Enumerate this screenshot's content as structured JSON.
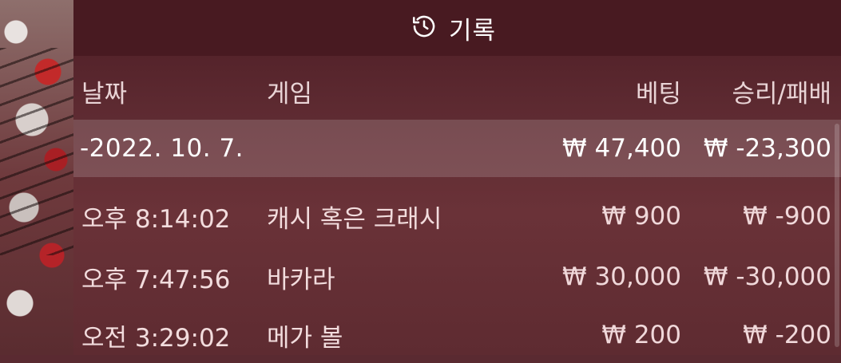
{
  "header": {
    "title": "기록",
    "icon": "history-icon"
  },
  "columns": {
    "date": "날짜",
    "game": "게임",
    "bet": "베팅",
    "winloss": "승리/패배"
  },
  "groups": [
    {
      "date_label": "-2022. 10. 7.",
      "bet_total": "₩ 47,400",
      "winloss_total": "₩ -23,300",
      "entries": [
        {
          "time": "오후 8:14:02",
          "game": "캐시 혹은 크래시",
          "bet": "₩ 900",
          "winloss": "₩ -900"
        },
        {
          "time": "오후 7:47:56",
          "game": "바카라",
          "bet": "₩ 30,000",
          "winloss": "₩ -30,000"
        },
        {
          "time": "오전 3:29:02",
          "game": "메가 볼",
          "bet": "₩ 200",
          "winloss": "₩ -200"
        }
      ]
    }
  ]
}
